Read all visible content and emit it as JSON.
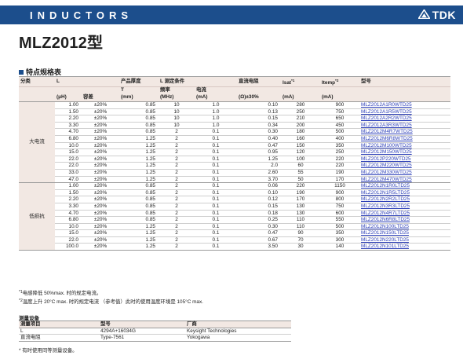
{
  "header": {
    "category": "INDUCTORS",
    "brand": "TDK",
    "brand_icon": "tdk-logo-icon"
  },
  "title": "MLZ2012型",
  "section": "特点规格表",
  "table": {
    "headers1": [
      "分类",
      "L",
      "",
      "产品厚度",
      "L 测定条件",
      "",
      "直流电阻",
      "Isat",
      "Itemp",
      "型号"
    ],
    "headers1_sup": {
      "isat": "*1",
      "itemp": "*2"
    },
    "headers2": [
      "",
      "",
      "",
      "T",
      "频率",
      "电流",
      "",
      "",
      "",
      ""
    ],
    "headers3": [
      "",
      "(μH)",
      "容差",
      "(mm)",
      "(MHz)",
      "(mA)",
      "(Ω)±30%",
      "(mA)",
      "(mA)",
      ""
    ],
    "groups": [
      {
        "label": "大电流",
        "rows": [
          [
            "1.00",
            "±20%",
            "0.85",
            "10",
            "1.0",
            "0.10",
            "280",
            "900",
            "MLZ2012A1R0WTD25"
          ],
          [
            "1.50",
            "±20%",
            "0.85",
            "10",
            "1.0",
            "0.13",
            "250",
            "750",
            "MLZ2012A1R5WTD25"
          ],
          [
            "2.20",
            "±20%",
            "0.85",
            "10",
            "1.0",
            "0.15",
            "210",
            "650",
            "MLZ2012A2R2WTD25"
          ],
          [
            "3.30",
            "±20%",
            "0.85",
            "10",
            "1.0",
            "0.34",
            "200",
            "450",
            "MLZ2012A3R3WTD25"
          ],
          [
            "4.70",
            "±20%",
            "0.85",
            "2",
            "0.1",
            "0.30",
            "180",
            "500",
            "MLZ2012M4R7WTD25"
          ],
          [
            "6.80",
            "±20%",
            "1.25",
            "2",
            "0.1",
            "0.40",
            "160",
            "400",
            "MLZ2012M6R8WTD25"
          ],
          [
            "10.0",
            "±20%",
            "1.25",
            "2",
            "0.1",
            "0.47",
            "150",
            "350",
            "MLZ2012M100WTD25"
          ],
          [
            "15.0",
            "±20%",
            "1.25",
            "2",
            "0.1",
            "0.95",
            "120",
            "250",
            "MLZ2012M150WTD25"
          ],
          [
            "22.0",
            "±20%",
            "1.25",
            "2",
            "0.1",
            "1.25",
            "100",
            "220",
            "MLZ2012P220WTD25"
          ],
          [
            "22.0",
            "±20%",
            "1.25",
            "2",
            "0.1",
            "2.0",
            "60",
            "220",
            "MLZ2012M220WTD25"
          ],
          [
            "33.0",
            "±20%",
            "1.25",
            "2",
            "0.1",
            "2.60",
            "55",
            "190",
            "MLZ2012M330WTD25"
          ],
          [
            "47.0",
            "±20%",
            "1.25",
            "2",
            "0.1",
            "3.70",
            "50",
            "170",
            "MLZ2012M470WTD25"
          ]
        ]
      },
      {
        "label": "低损抗",
        "rows": [
          [
            "1.00",
            "±20%",
            "0.85",
            "2",
            "0.1",
            "0.06",
            "220",
            "1150",
            "MLZ2012N1R0LTD25"
          ],
          [
            "1.50",
            "±20%",
            "0.85",
            "2",
            "0.1",
            "0.10",
            "190",
            "900",
            "MLZ2012N1R5LTD25"
          ],
          [
            "2.20",
            "±20%",
            "0.85",
            "2",
            "0.1",
            "0.12",
            "170",
            "800",
            "MLZ2012N2R2LTD25"
          ],
          [
            "3.30",
            "±20%",
            "0.85",
            "2",
            "0.1",
            "0.15",
            "130",
            "750",
            "MLZ2012N3R3LTD25"
          ],
          [
            "4.70",
            "±20%",
            "0.85",
            "2",
            "0.1",
            "0.18",
            "130",
            "600",
            "MLZ2012N4R7LTD25"
          ],
          [
            "6.80",
            "±20%",
            "0.85",
            "2",
            "0.1",
            "0.25",
            "110",
            "550",
            "MLZ2012N6R8LTD25"
          ],
          [
            "10.0",
            "±20%",
            "1.25",
            "2",
            "0.1",
            "0.30",
            "110",
            "500",
            "MLZ2012N100LTD25"
          ],
          [
            "15.0",
            "±20%",
            "1.25",
            "2",
            "0.1",
            "0.47",
            "90",
            "350",
            "MLZ2012N150LTD25"
          ],
          [
            "22.0",
            "±20%",
            "1.25",
            "2",
            "0.1",
            "0.67",
            "70",
            "300",
            "MLZ2012N220LTD25"
          ],
          [
            "100.0",
            "±20%",
            "1.25",
            "2",
            "0.1",
            "3.50",
            "30",
            "140",
            "MLZ2012N101LTD25"
          ]
        ]
      }
    ]
  },
  "notes": [
    {
      "mark": "*1",
      "text": "电感降低 50%max. 时的规定电流。"
    },
    {
      "mark": "*2",
      "text": "温度上升 20°C max. 时的规定电流 （参考值）此时的使用温度环境是 105°C max."
    }
  ],
  "equipment": {
    "title": "测量设备",
    "headers": [
      "测量项目",
      "型号",
      "厂商"
    ],
    "rows": [
      [
        "L",
        "4294A+16034G",
        "Keysight Technologies"
      ],
      [
        "直流电阻",
        "Type-7561",
        "Yokogawa"
      ]
    ],
    "footnote": "* 有时使用同等测量设备。"
  }
}
